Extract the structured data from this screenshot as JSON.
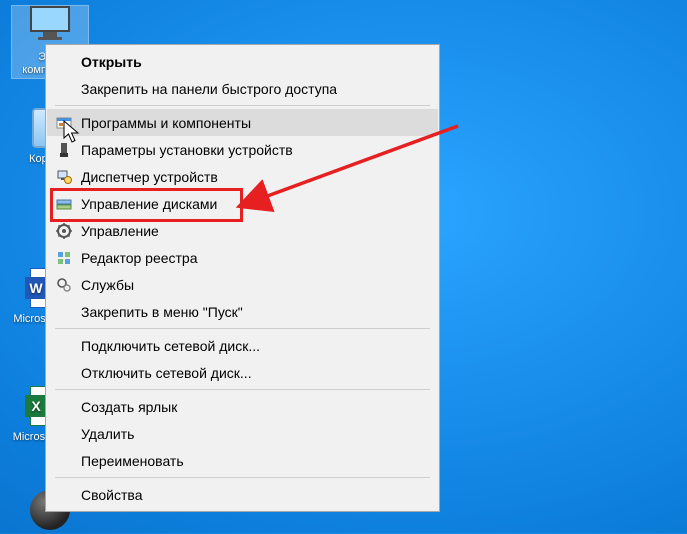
{
  "desktop": {
    "icons": [
      {
        "label": "Этот\nкомпьютер",
        "kind": "pc"
      },
      {
        "label": "Корзина",
        "kind": "bin"
      },
      {
        "label": "Microsoft\nEdge",
        "kind": "word"
      },
      {
        "label": "Microsoft\nExcel",
        "kind": "excel"
      }
    ]
  },
  "context_menu": {
    "items": [
      {
        "label": "Открыть",
        "bold": true
      },
      {
        "label": "Закрепить на панели быстрого доступа"
      },
      {
        "sep": true
      },
      {
        "label": "Программы и компоненты",
        "icon": "programs-icon",
        "hover": true
      },
      {
        "label": "Параметры установки устройств",
        "icon": "device-settings-icon"
      },
      {
        "label": "Диспетчер устройств",
        "icon": "device-manager-icon"
      },
      {
        "label": "Управление дисками",
        "icon": "disk-management-icon",
        "highlighted": true
      },
      {
        "label": "Управление",
        "icon": "manage-icon"
      },
      {
        "label": "Редактор реестра",
        "icon": "registry-icon"
      },
      {
        "label": "Службы",
        "icon": "services-icon"
      },
      {
        "label": "Закрепить в меню \"Пуск\""
      },
      {
        "sep": true
      },
      {
        "label": "Подключить сетевой диск..."
      },
      {
        "label": "Отключить сетевой диск..."
      },
      {
        "sep": true
      },
      {
        "label": "Создать ярлык"
      },
      {
        "label": "Удалить"
      },
      {
        "label": "Переименовать"
      },
      {
        "sep": true
      },
      {
        "label": "Свойства"
      }
    ]
  },
  "annotation": {
    "highlight_color": "#e62020"
  }
}
